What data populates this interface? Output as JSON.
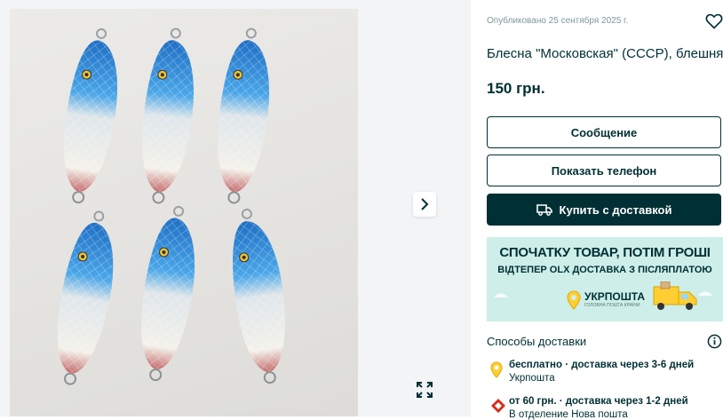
{
  "listing": {
    "published": "Опубликовано 25 сентября 2025 г.",
    "title": "Блесна \"Московская\" (СССР), блешня",
    "price": "150 грн."
  },
  "buttons": {
    "message": "Сообщение",
    "show_phone": "Показать телефон",
    "buy_with_delivery": "Купить с доставкой"
  },
  "banner": {
    "headline": "СПОЧАТКУ ТОВАР, ПОТІМ ГРОШІ",
    "subline": "ВІДТЕПЕР OLX ДОСТАВКА З ПІСЛЯПЛАТОЮ",
    "brand": "УКРПОШТА",
    "brand_tagline": "ГОЛОВНА ПОШТА КРАЇНИ"
  },
  "delivery": {
    "title": "Способы доставки",
    "options": [
      {
        "line1": "бесплатно · доставка через 3-6 дней",
        "line2": "Укрпошта",
        "icon": "pin-icon"
      },
      {
        "line1": "от 60 грн. · доставка через 1-2 дней",
        "line2": "В отделение Нова пошта",
        "icon": "nova-poshta-icon"
      }
    ]
  },
  "colors": {
    "primary": "#002f34",
    "banner_bg": "#cdeee9",
    "pin_yellow": "#ffce32",
    "nova_red": "#da291c",
    "lure_blue": "#2a7fd0"
  },
  "icons": [
    "heart-icon",
    "chevron-right-icon",
    "expand-icon",
    "truck-icon",
    "info-icon"
  ]
}
